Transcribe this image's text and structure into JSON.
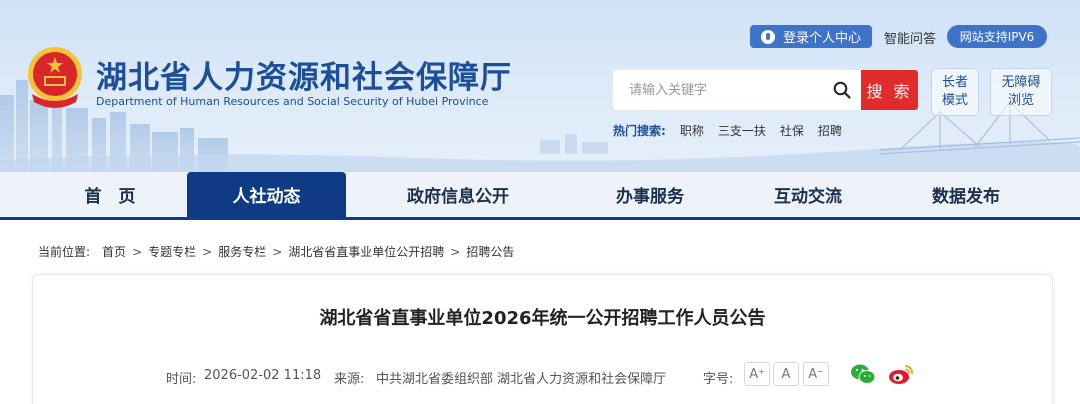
{
  "header": {
    "title": "湖北省人力资源和社会保障厅",
    "subtitle": "Department of Human Resources and Social Security of Hubei Province",
    "login_label": "登录个人中心",
    "qa_label": "智能问答",
    "ipv6_label": "网站支持IPV6",
    "search_placeholder": "请输入关键字",
    "search_button": "搜 索",
    "elder_mode": [
      "长者",
      "模式"
    ],
    "accessible": [
      "无障碍",
      "浏览"
    ],
    "hot_label": "热门搜索:",
    "hot_items": [
      "职称",
      "三支一扶",
      "社保",
      "招聘"
    ]
  },
  "nav": {
    "items": [
      "首　页",
      "人社动态",
      "政府信息公开",
      "办事服务",
      "互动交流",
      "数据发布"
    ],
    "active_index": 1
  },
  "breadcrumb": {
    "label": "当前位置:",
    "items": [
      "首页",
      "专题专栏",
      "服务专栏",
      "湖北省省直事业单位公开招聘",
      "招聘公告"
    ]
  },
  "article": {
    "title": "湖北省省直事业单位2026年统一公开招聘工作人员公告",
    "time_label": "时间:",
    "time": "2026-02-02 11:18",
    "source_label": "来源:",
    "source": "中共湖北省委组织部 湖北省人力资源和社会保障厅",
    "font_label": "字号:",
    "font_sizes": [
      "A",
      "A",
      "A"
    ]
  },
  "colors": {
    "brand": "#1c4e9a",
    "nav_active": "#0f3b85",
    "search_button": "#e02c2c",
    "login_button": "#3f73c9"
  },
  "icons": {
    "emblem": "national-emblem-icon",
    "search": "search-icon",
    "user": "user-icon",
    "wechat": "wechat-icon",
    "weibo": "weibo-icon"
  }
}
